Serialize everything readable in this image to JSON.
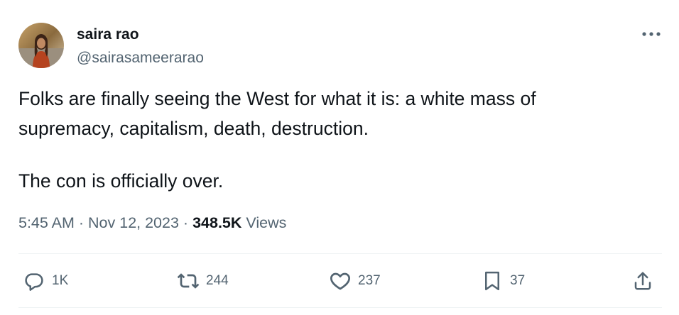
{
  "author": {
    "display_name": "saira rao",
    "handle": "@sairasameerarao"
  },
  "tweet": {
    "lines": [
      "Folks are finally seeing the West for what it is: a white mass of",
      "supremacy, capitalism, death, destruction.",
      "The con is officially over."
    ]
  },
  "meta": {
    "time": "5:45 AM",
    "separator": "·",
    "date": "Nov 12, 2023",
    "views_count": "348.5K",
    "views_label": "Views"
  },
  "actions": {
    "replies": "1K",
    "retweets": "244",
    "likes": "237",
    "bookmarks": "37"
  },
  "icons": {
    "more": "more-horizontal-icon",
    "reply": "reply-icon",
    "retweet": "retweet-icon",
    "like": "heart-icon",
    "bookmark": "bookmark-icon",
    "share": "share-icon"
  },
  "colors": {
    "text": "#0f1419",
    "secondary": "#536471",
    "divider": "#eff3f4"
  }
}
